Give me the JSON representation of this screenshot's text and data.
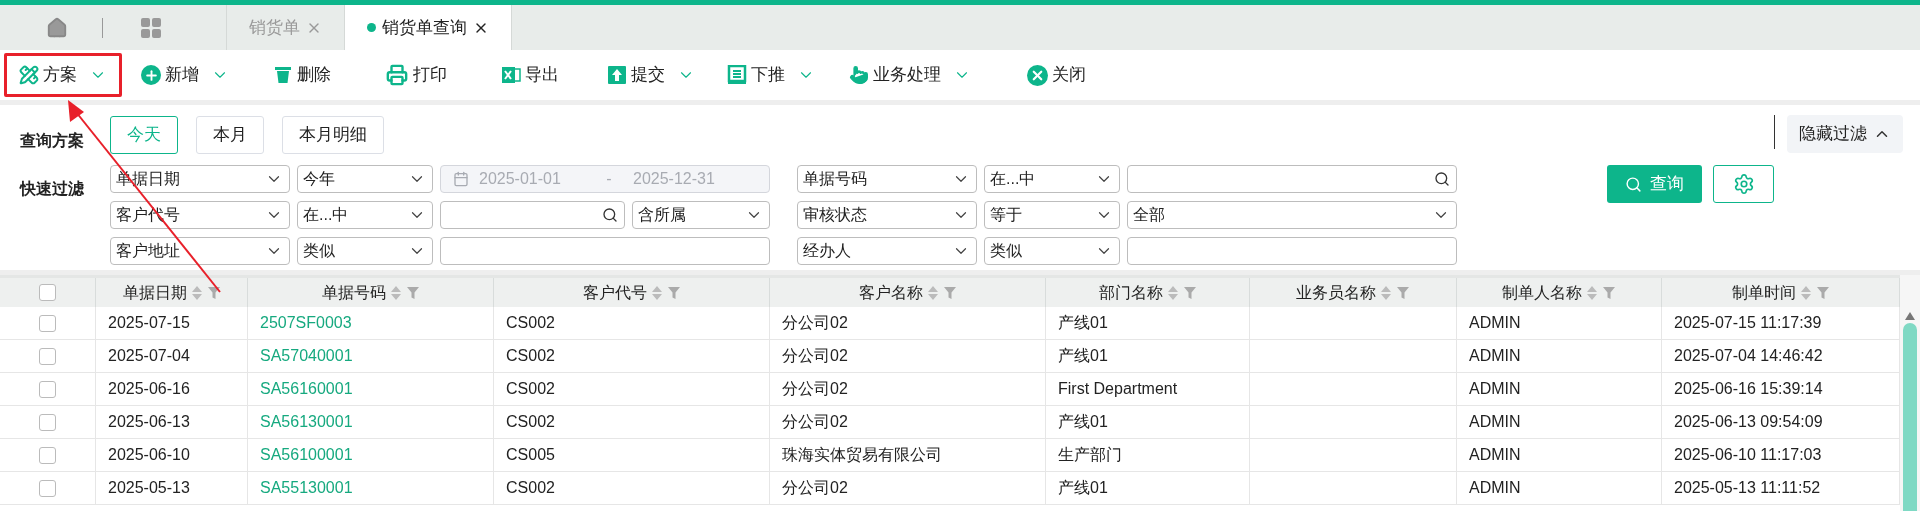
{
  "top_tabs": [
    {
      "label": "销货单",
      "selected": false
    },
    {
      "label": "销货单查询",
      "selected": true
    }
  ],
  "toolbar": [
    {
      "label": "方案",
      "dropdown": true,
      "annotated": true
    },
    {
      "label": "新增",
      "dropdown": true,
      "annotated": false
    },
    {
      "label": "删除",
      "dropdown": false,
      "annotated": false
    },
    {
      "label": "打印",
      "dropdown": false,
      "annotated": false
    },
    {
      "label": "导出",
      "dropdown": false,
      "annotated": false
    },
    {
      "label": "提交",
      "dropdown": true,
      "annotated": false
    },
    {
      "label": "下推",
      "dropdown": true,
      "annotated": false
    },
    {
      "label": "业务处理",
      "dropdown": true,
      "annotated": false
    },
    {
      "label": "关闭",
      "dropdown": false,
      "annotated": false
    }
  ],
  "query_plan": {
    "label": "查询方案",
    "options": [
      {
        "label": "今天",
        "selected": true
      },
      {
        "label": "本月",
        "selected": false
      },
      {
        "label": "本月明细",
        "selected": false
      }
    ]
  },
  "hide_filter": {
    "label": "隐藏过滤"
  },
  "quick_filter": {
    "label": "快速过滤",
    "groups": [
      [
        {
          "field": "单据日期",
          "operator": "今年",
          "value": {
            "kind": "date_range",
            "start": "2025-01-01",
            "separator": "-",
            "end": "2025-12-31",
            "disabled": true
          }
        },
        {
          "field": "客户代号",
          "operator": "在...中",
          "value": {
            "kind": "search",
            "scope": "含所属"
          }
        },
        {
          "field": "客户地址",
          "operator": "类似",
          "value": {
            "kind": "text"
          }
        }
      ],
      [
        {
          "field": "单据号码",
          "operator": "在...中",
          "value": {
            "kind": "search"
          }
        },
        {
          "field": "审核状态",
          "operator": "等于",
          "value": {
            "kind": "select",
            "value": "全部"
          }
        },
        {
          "field": "经办人",
          "operator": "类似",
          "value": {
            "kind": "text"
          }
        }
      ]
    ]
  },
  "query_button": {
    "label": "查询"
  },
  "table": {
    "all_selected": false,
    "columns": [
      {
        "label": "单据日期",
        "kind": "text"
      },
      {
        "label": "单据号码",
        "kind": "link"
      },
      {
        "label": "客户代号",
        "kind": "text"
      },
      {
        "label": "客户名称",
        "kind": "text"
      },
      {
        "label": "部门名称",
        "kind": "text"
      },
      {
        "label": "业务员名称",
        "kind": "text"
      },
      {
        "label": "制单人名称",
        "kind": "text"
      },
      {
        "label": "制单时间",
        "kind": "text"
      }
    ],
    "rows": [
      {
        "selected": false,
        "cells": [
          "2025-07-15",
          "2507SF0003",
          "CS002",
          "分公司02",
          "产线01",
          null,
          "ADMIN",
          "2025-07-15 11:17:39"
        ]
      },
      {
        "selected": false,
        "cells": [
          "2025-07-04",
          "SA57040001",
          "CS002",
          "分公司02",
          "产线01",
          null,
          "ADMIN",
          "2025-07-04 14:46:42"
        ]
      },
      {
        "selected": false,
        "cells": [
          "2025-06-16",
          "SA56160001",
          "CS002",
          "分公司02",
          "First Department",
          null,
          "ADMIN",
          "2025-06-16 15:39:14"
        ]
      },
      {
        "selected": false,
        "cells": [
          "2025-06-13",
          "SA56130001",
          "CS002",
          "分公司02",
          "产线01",
          null,
          "ADMIN",
          "2025-06-13 09:54:09"
        ]
      },
      {
        "selected": false,
        "cells": [
          "2025-06-10",
          "SA56100001",
          "CS005",
          "珠海实体贸易有限公司",
          "生产部门",
          null,
          "ADMIN",
          "2025-06-10 11:17:03"
        ]
      },
      {
        "selected": false,
        "cells": [
          "2025-05-13",
          "SA55130001",
          "CS002",
          "分公司02",
          "产线01",
          null,
          "ADMIN",
          "2025-05-13 11:11:52"
        ]
      }
    ]
  }
}
